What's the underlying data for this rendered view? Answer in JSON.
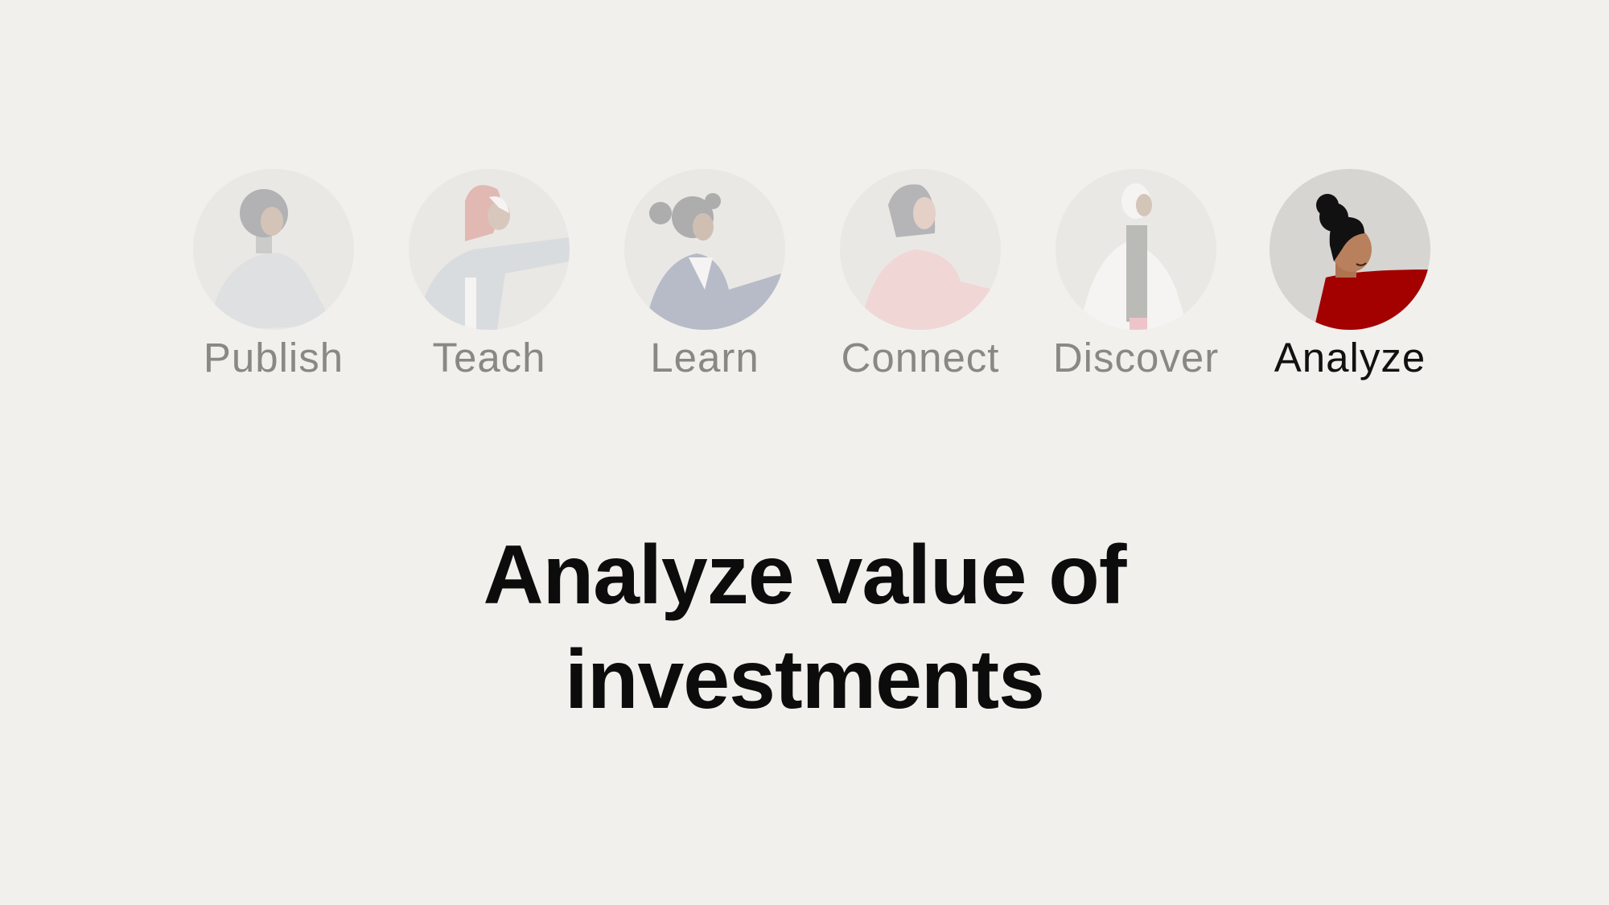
{
  "tabs": [
    {
      "id": "publish",
      "label": "Publish",
      "active": false
    },
    {
      "id": "teach",
      "label": "Teach",
      "active": false
    },
    {
      "id": "learn",
      "label": "Learn",
      "active": false
    },
    {
      "id": "connect",
      "label": "Connect",
      "active": false
    },
    {
      "id": "discover",
      "label": "Discover",
      "active": false
    },
    {
      "id": "analyze",
      "label": "Analyze",
      "active": true
    }
  ],
  "headline": {
    "line1": "Analyze value of",
    "line2": "investments"
  },
  "colors": {
    "background": "#f1f0ec",
    "active_text": "#111111",
    "inactive_text": "#8a8884",
    "accent_red": "#a30000"
  }
}
